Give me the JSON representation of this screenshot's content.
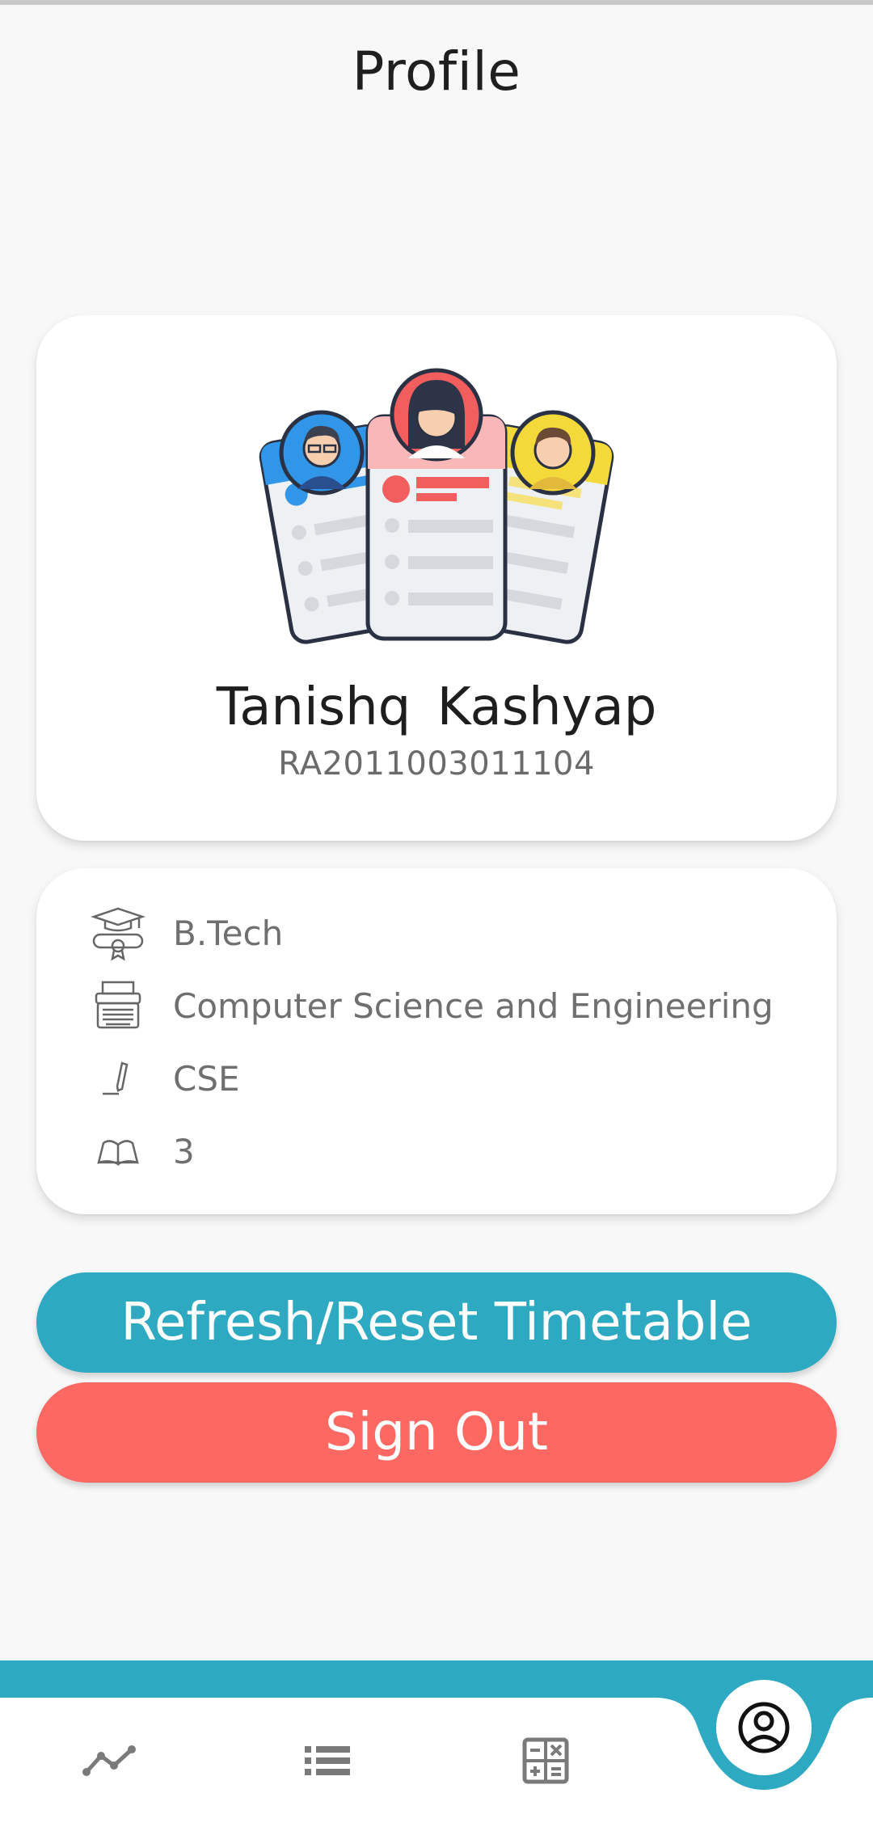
{
  "header": {
    "title": "Profile"
  },
  "profile": {
    "name": "Tanishq  Kashyap",
    "registration_number": "RA2011003011104"
  },
  "details": [
    {
      "icon": "graduation-cap-icon",
      "value": "B.Tech"
    },
    {
      "icon": "typewriter-icon",
      "value": "Computer Science and Engineering"
    },
    {
      "icon": "pen-icon",
      "value": "CSE"
    },
    {
      "icon": "open-book-icon",
      "value": "3"
    }
  ],
  "actions": {
    "refresh_label": "Refresh/Reset Timetable",
    "signout_label": "Sign Out"
  },
  "bottom_nav": {
    "items": [
      {
        "icon": "line-chart-icon",
        "active": false
      },
      {
        "icon": "list-icon",
        "active": false
      },
      {
        "icon": "calculator-icon",
        "active": false
      },
      {
        "icon": "account-circle-icon",
        "active": true
      }
    ]
  },
  "colors": {
    "accent": "#2ea9c2",
    "danger": "#fd6962",
    "background": "#f8f8f8",
    "card": "#ffffff"
  }
}
